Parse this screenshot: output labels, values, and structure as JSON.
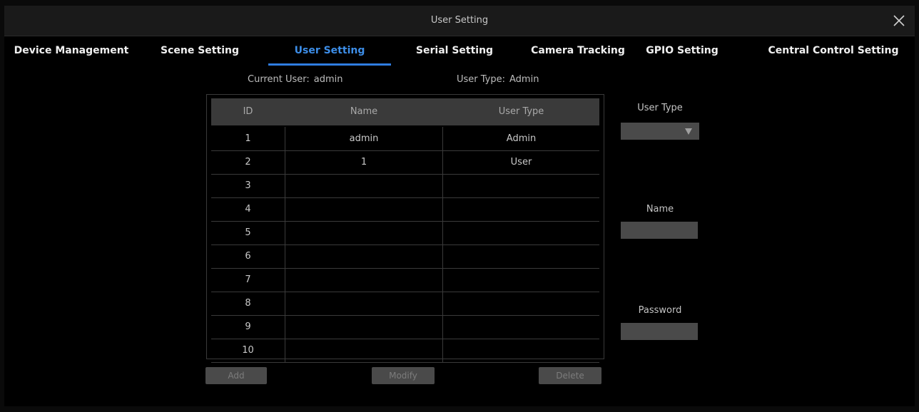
{
  "window": {
    "title": "User Setting"
  },
  "tabs": [
    {
      "label": "Device Management"
    },
    {
      "label": "Scene Setting"
    },
    {
      "label": "User Setting"
    },
    {
      "label": "Serial Setting"
    },
    {
      "label": "Camera Tracking"
    },
    {
      "label": "GPIO Setting"
    },
    {
      "label": "Central Control Setting"
    }
  ],
  "active_tab": "User Setting",
  "status": {
    "current_user_label": "Current User:",
    "current_user_value": "admin",
    "user_type_label": "User Type:",
    "user_type_value": "Admin"
  },
  "table": {
    "headers": [
      "ID",
      "Name",
      "User Type"
    ],
    "rows": [
      {
        "id": "1",
        "name": "admin",
        "type": "Admin"
      },
      {
        "id": "2",
        "name": "1",
        "type": "User"
      },
      {
        "id": "3",
        "name": "",
        "type": ""
      },
      {
        "id": "4",
        "name": "",
        "type": ""
      },
      {
        "id": "5",
        "name": "",
        "type": ""
      },
      {
        "id": "6",
        "name": "",
        "type": ""
      },
      {
        "id": "7",
        "name": "",
        "type": ""
      },
      {
        "id": "8",
        "name": "",
        "type": ""
      },
      {
        "id": "9",
        "name": "",
        "type": ""
      },
      {
        "id": "10",
        "name": "",
        "type": ""
      }
    ]
  },
  "buttons": {
    "add": "Add",
    "modify": "Modify",
    "delete": "Delete"
  },
  "form": {
    "user_type_label": "User Type",
    "user_type_value": "",
    "name_label": "Name",
    "name_value": "",
    "password_label": "Password",
    "password_value": ""
  },
  "colors": {
    "accent": "#2f7de1",
    "background": "#000000",
    "titlebar": "#1a1a1a"
  },
  "icons": {
    "close": "close-icon",
    "dropdown": "dropdown-arrow-icon"
  }
}
